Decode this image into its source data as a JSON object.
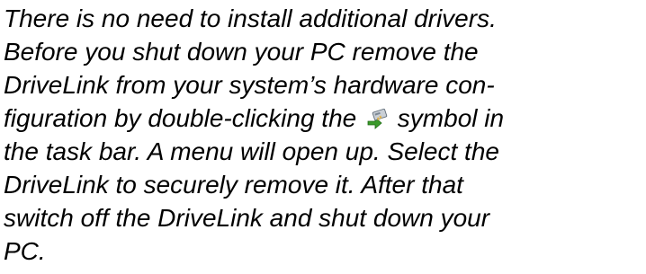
{
  "document": {
    "lines": [
      "There is no need to install additional drivers.",
      "Before you shut down your PC remove the",
      "DriveLink from your system’s hardware con-",
      "figuration by double-clicking the",
      "symbol in",
      "the task bar. A menu will open up. Select the",
      "DriveLink to securely remove it. After that",
      "switch off the DriveLink and shut down your",
      "PC."
    ],
    "icon": "safely-remove-hardware-icon"
  }
}
